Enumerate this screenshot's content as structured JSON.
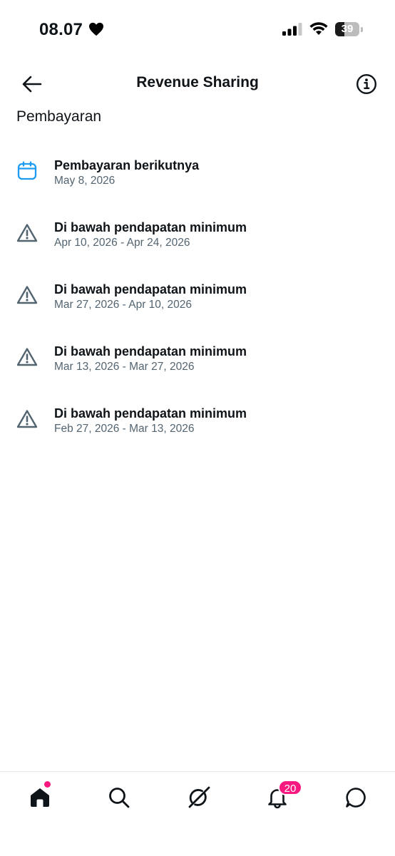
{
  "status_bar": {
    "time": "08.07",
    "battery_text": "39",
    "battery_level": 0.39
  },
  "header": {
    "title": "Revenue Sharing",
    "back_icon": "arrow-left-icon",
    "info_icon": "info-circle-icon"
  },
  "section": {
    "title": "Pembayaran"
  },
  "payments": [
    {
      "icon": "calendar-icon",
      "icon_color": "#1d9bf0",
      "title": "Pembayaran berikutnya",
      "date": "May 8, 2026"
    },
    {
      "icon": "warning-icon",
      "icon_color": "#536471",
      "title": "Di bawah pendapatan minimum",
      "date": "Apr 10, 2026 - Apr 24, 2026"
    },
    {
      "icon": "warning-icon",
      "icon_color": "#536471",
      "title": "Di bawah pendapatan minimum",
      "date": "Mar 27, 2026 - Apr 10, 2026"
    },
    {
      "icon": "warning-icon",
      "icon_color": "#536471",
      "title": "Di bawah pendapatan minimum",
      "date": "Mar 13, 2026 - Mar 27, 2026"
    },
    {
      "icon": "warning-icon",
      "icon_color": "#536471",
      "title": "Di bawah pendapatan minimum",
      "date": "Feb 27, 2026 - Mar 13, 2026"
    }
  ],
  "bottom_nav": {
    "items": [
      {
        "icon": "home-icon"
      },
      {
        "icon": "search-icon"
      },
      {
        "icon": "grok-icon"
      },
      {
        "icon": "bell-icon"
      },
      {
        "icon": "chat-icon"
      }
    ],
    "notification_count": "20",
    "badge_color": "#f91880"
  }
}
